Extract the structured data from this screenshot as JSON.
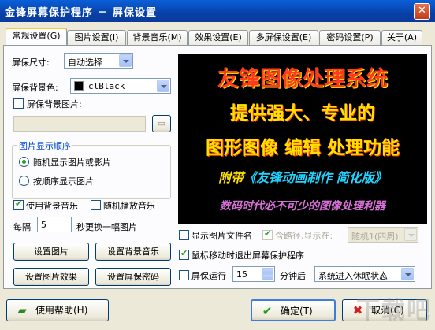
{
  "window": {
    "title": "金锋屏幕保护程序 － 屏保设置",
    "close_label": "✕"
  },
  "tabs": [
    {
      "label": "常规设置(G)"
    },
    {
      "label": "图片设置(I)"
    },
    {
      "label": "背景音乐(M)"
    },
    {
      "label": "效果设置(E)"
    },
    {
      "label": "多屏保设置(E)"
    },
    {
      "label": "密码设置(P)"
    },
    {
      "label": "关于(A)"
    }
  ],
  "general": {
    "size_label": "屏保尺寸:",
    "size_value": "自动选择",
    "bgcolor_label": "屏保背景色:",
    "bgcolor_value": "clBlack",
    "bg_image_label": "屏保背景图片:",
    "order_group_title": "图片显示顺序",
    "order_random": "随机显示图片或影片",
    "order_sequential": "按顺序显示图片",
    "use_music": "使用背景音乐",
    "random_music": "随机播放音乐",
    "every_label": "每隔",
    "every_value": "5",
    "every_suffix": "秒更换一幅图片",
    "btn_set_image": "设置图片",
    "btn_set_music": "设置背景音乐",
    "btn_image_effect": "设置图片效果",
    "btn_password": "设置屏保密码"
  },
  "preview": {
    "line1": "友锋图像处理系统",
    "line2": "提供强大、专业的",
    "line3": "图形图像 编辑 处理功能",
    "line4_prefix": "附带",
    "line4_highlight": "《友锋动画制作 简化版》",
    "line5": "数码时代必不可少的图像处理利器"
  },
  "options": {
    "show_filename": "显示图片文件名",
    "include_path": "含路径,显示在:",
    "position_value": "随机1(四周)",
    "exit_on_mouse": "鼠标移动时退出屏幕保护程序",
    "run_label": "屏保运行",
    "run_value": "15",
    "run_suffix": "分钟后",
    "sleep_value": "系统进入休眠状态"
  },
  "footer": {
    "help": "使用帮助(H)",
    "ok": "确定(T)",
    "cancel": "取消(C)"
  },
  "watermark": "下载吧"
}
